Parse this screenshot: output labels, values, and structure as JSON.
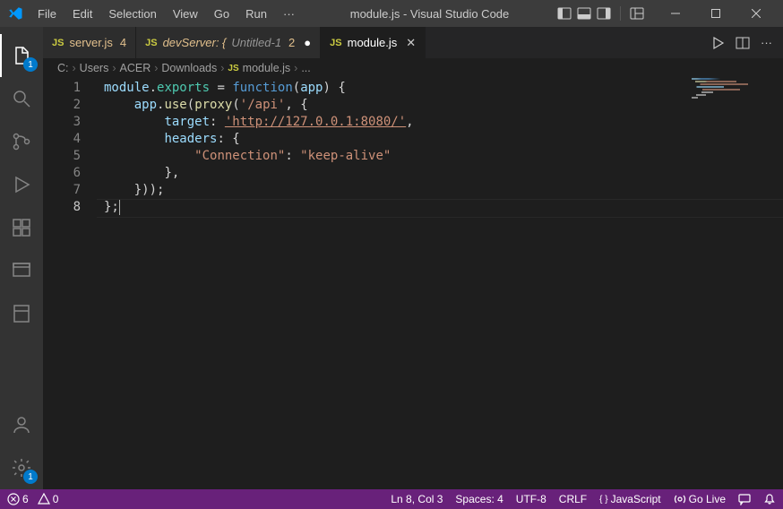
{
  "titlebar": {
    "menu": [
      "File",
      "Edit",
      "Selection",
      "View",
      "Go",
      "Run",
      "···"
    ],
    "title": "module.js - Visual Studio Code"
  },
  "activitybar": {
    "explorer_badge": "1",
    "settings_badge": "1"
  },
  "tabs": [
    {
      "icon": "JS",
      "name": "server.js",
      "count": "4",
      "modified": false,
      "italic": false,
      "active": false,
      "close": false
    },
    {
      "icon": "JS",
      "name": "devServer: {",
      "sub": "Untitled-1",
      "count": "2",
      "modified": true,
      "italic": true,
      "active": false,
      "close": false
    },
    {
      "icon": "JS",
      "name": "module.js",
      "modified": false,
      "italic": false,
      "active": true,
      "close": true
    }
  ],
  "breadcrumb": [
    "C:",
    "Users",
    "ACER",
    "Downloads",
    "module.js",
    "..."
  ],
  "breadcrumb_file_icon": "JS",
  "code": {
    "lines": [
      {
        "n": 1,
        "tokens": [
          {
            "t": "module",
            "c": "tok-id"
          },
          {
            "t": ".",
            "c": "tok-pun"
          },
          {
            "t": "exports",
            "c": "tok-export"
          },
          {
            "t": " = ",
            "c": "tok-op"
          },
          {
            "t": "function",
            "c": "tok-kw"
          },
          {
            "t": "(",
            "c": "tok-pun"
          },
          {
            "t": "app",
            "c": "tok-id"
          },
          {
            "t": ") {",
            "c": "tok-pun"
          }
        ]
      },
      {
        "n": 2,
        "indent": "    ",
        "tokens": [
          {
            "t": "app",
            "c": "tok-id"
          },
          {
            "t": ".",
            "c": "tok-pun"
          },
          {
            "t": "use",
            "c": "tok-fn"
          },
          {
            "t": "(",
            "c": "tok-pun"
          },
          {
            "t": "proxy",
            "c": "tok-fn"
          },
          {
            "t": "(",
            "c": "tok-pun"
          },
          {
            "t": "'/api'",
            "c": "tok-str"
          },
          {
            "t": ", {",
            "c": "tok-pun"
          }
        ]
      },
      {
        "n": 3,
        "indent": "        ",
        "tokens": [
          {
            "t": "target",
            "c": "tok-prop"
          },
          {
            "t": ": ",
            "c": "tok-pun"
          },
          {
            "t": "'http://127.0.0.1:8080/'",
            "c": "tok-str underline"
          },
          {
            "t": ",",
            "c": "tok-pun"
          }
        ]
      },
      {
        "n": 4,
        "indent": "        ",
        "tokens": [
          {
            "t": "headers",
            "c": "tok-prop"
          },
          {
            "t": ": {",
            "c": "tok-pun"
          }
        ]
      },
      {
        "n": 5,
        "indent": "            ",
        "tokens": [
          {
            "t": "\"Connection\"",
            "c": "tok-str"
          },
          {
            "t": ": ",
            "c": "tok-pun"
          },
          {
            "t": "\"keep-alive\"",
            "c": "tok-str"
          }
        ]
      },
      {
        "n": 6,
        "indent": "        ",
        "tokens": [
          {
            "t": "},",
            "c": "tok-pun"
          }
        ]
      },
      {
        "n": 7,
        "indent": "    ",
        "tokens": [
          {
            "t": "}));",
            "c": "tok-pun"
          }
        ]
      },
      {
        "n": 8,
        "tokens": [
          {
            "t": "};",
            "c": "tok-pun"
          }
        ],
        "cursor_after": true,
        "current": true
      }
    ]
  },
  "statusbar": {
    "errors": "0",
    "warnings": "0",
    "port": "6",
    "radio": "0",
    "cursor": "Ln 8, Col 3",
    "spaces": "Spaces: 4",
    "encoding": "UTF-8",
    "eol": "CRLF",
    "lang": "JavaScript",
    "golive": "Go Live"
  }
}
